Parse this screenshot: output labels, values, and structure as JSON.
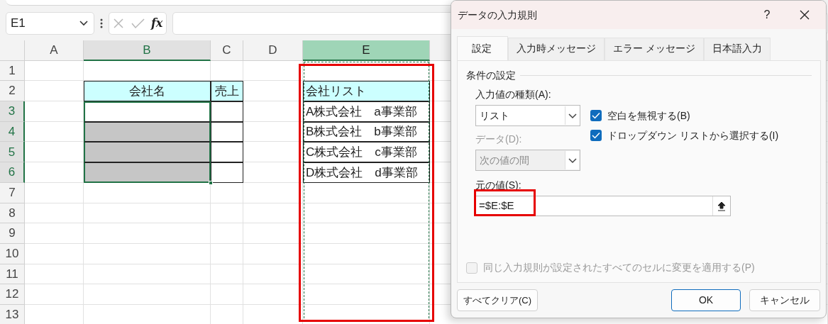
{
  "name_box": {
    "value": "E1"
  },
  "formula_bar": {
    "function_label": "fx"
  },
  "columns": [
    {
      "label": "A",
      "selected": false,
      "active": false,
      "copied": false
    },
    {
      "label": "B",
      "selected": true,
      "active": false,
      "copied": false
    },
    {
      "label": "C",
      "selected": false,
      "active": false,
      "copied": false
    },
    {
      "label": "D",
      "selected": false,
      "active": false,
      "copied": false
    },
    {
      "label": "E",
      "selected": true,
      "active": true,
      "copied": true
    }
  ],
  "rows": [
    {
      "label": "1",
      "selected": false
    },
    {
      "label": "2",
      "selected": false,
      "cells": [
        {
          "kind": "blank",
          "selected": false
        },
        {
          "kind": "header",
          "text": "会社名",
          "selected": false
        },
        {
          "kind": "header",
          "text": "売上",
          "selected": false
        },
        {
          "kind": "blank",
          "selected": false
        },
        {
          "kind": "listhead",
          "text": "会社リスト",
          "selected": false
        }
      ]
    },
    {
      "label": "3",
      "selected": true,
      "cells": [
        {
          "kind": "blank",
          "selected": false
        },
        {
          "kind": "input",
          "selected": true
        },
        {
          "kind": "input",
          "selected": false
        },
        {
          "kind": "blank",
          "selected": false
        },
        {
          "kind": "list",
          "text": "A株式会社　a事業部",
          "selected": false
        }
      ]
    },
    {
      "label": "4",
      "selected": true,
      "cells": [
        {
          "kind": "blank",
          "selected": false
        },
        {
          "kind": "shaded",
          "selected": true
        },
        {
          "kind": "input",
          "selected": false
        },
        {
          "kind": "blank",
          "selected": false
        },
        {
          "kind": "list",
          "text": "B株式会社　b事業部",
          "selected": false
        }
      ]
    },
    {
      "label": "5",
      "selected": true,
      "cells": [
        {
          "kind": "blank",
          "selected": false
        },
        {
          "kind": "shaded",
          "selected": true
        },
        {
          "kind": "input",
          "selected": false
        },
        {
          "kind": "blank",
          "selected": false
        },
        {
          "kind": "list",
          "text": "C株式会社　c事業部",
          "selected": false
        }
      ]
    },
    {
      "label": "6",
      "selected": true,
      "cells": [
        {
          "kind": "blank",
          "selected": false
        },
        {
          "kind": "shaded",
          "selected": true
        },
        {
          "kind": "input",
          "selected": false
        },
        {
          "kind": "blank",
          "selected": false
        },
        {
          "kind": "list",
          "text": "D株式会社　d事業部",
          "selected": false
        }
      ]
    },
    {
      "label": "7",
      "selected": false
    },
    {
      "label": "8",
      "selected": false
    },
    {
      "label": "9",
      "selected": false
    },
    {
      "label": "10",
      "selected": false
    },
    {
      "label": "11",
      "selected": false
    },
    {
      "label": "12",
      "selected": false
    },
    {
      "label": "13",
      "selected": false
    }
  ],
  "dialog": {
    "title": "データの入力規則",
    "help": "?",
    "tabs": [
      {
        "label": "設定",
        "selected": true
      },
      {
        "label": "入力時メッセージ",
        "selected": false
      },
      {
        "label": "エラー メッセージ",
        "selected": false
      },
      {
        "label": "日本語入力",
        "selected": false
      }
    ],
    "section": "条件の設定",
    "type_label": "入力値の種類(A):",
    "type_value": "リスト",
    "data_label": "データ(D):",
    "data_value": "次の値の間",
    "data_disabled": true,
    "checkboxes": [
      {
        "label": "空白を無視する(B)",
        "checked": true
      },
      {
        "label": "ドロップダウン リストから選択する(I)",
        "checked": true
      }
    ],
    "source_label": "元の値(S):",
    "source_value": "=$E:$E",
    "apply_all": {
      "label": "同じ入力規則が設定されたすべてのセルに変更を適用する(P)",
      "checked": false,
      "disabled": true
    },
    "buttons": [
      {
        "label": "すべてクリア(C)",
        "kind": "secondary"
      },
      {
        "label": "OK",
        "kind": "default"
      },
      {
        "label": "キャンセル",
        "kind": "secondary"
      }
    ]
  }
}
